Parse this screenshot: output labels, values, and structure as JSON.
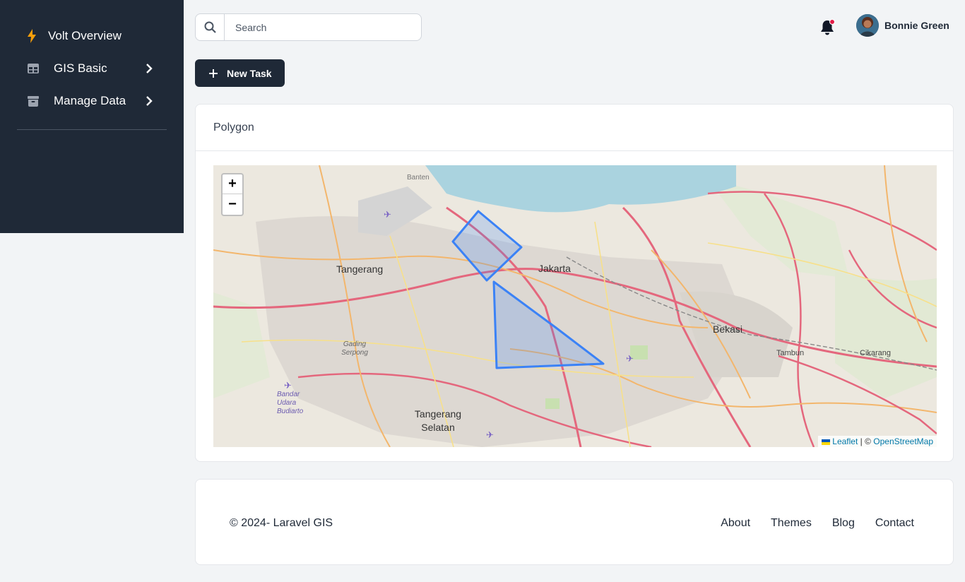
{
  "sidebar": {
    "brand": "Volt Overview",
    "items": [
      {
        "label": "GIS Basic",
        "icon": "table-icon"
      },
      {
        "label": "Manage Data",
        "icon": "archive-icon"
      }
    ]
  },
  "search": {
    "placeholder": "Search"
  },
  "user": {
    "name": "Bonnie Green"
  },
  "actions": {
    "new_task": "New Task"
  },
  "card": {
    "title": "Polygon"
  },
  "map": {
    "zoom_in": "+",
    "zoom_out": "−",
    "attribution_leaflet": "Leaflet",
    "attribution_sep": " | © ",
    "attribution_osm": "OpenStreetMap",
    "places": [
      "Banten",
      "Tangerang",
      "Jakarta",
      "Bekasi",
      "Tambun",
      "Cikarang",
      "Gading Serpong",
      "Tangerang Selatan",
      "Bandar Udara Budiarto"
    ],
    "polygon_color": "#3b82f6"
  },
  "footer": {
    "copyright": "© 2024- Laravel GIS",
    "links": [
      "About",
      "Themes",
      "Blog",
      "Contact"
    ]
  },
  "colors": {
    "sidebar_bg": "#1f2937",
    "brand_icon": "#f59e0b",
    "notification_dot": "#e11d48"
  }
}
